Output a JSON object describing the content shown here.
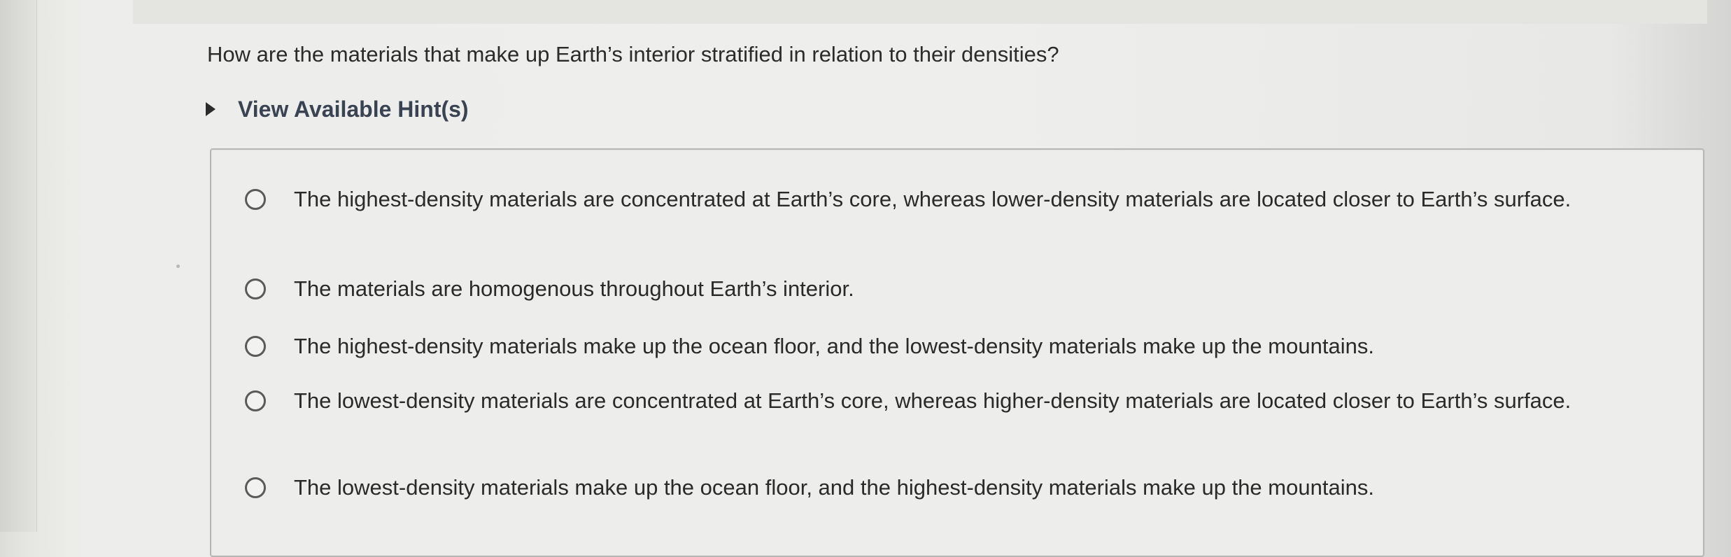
{
  "question": {
    "text": "How are the materials that make up Earth’s interior stratified in relation to their densities?"
  },
  "hint": {
    "label": "View Available Hint(s)",
    "icon": "triangle-right-icon"
  },
  "options": [
    {
      "text": "The highest-density materials are concentrated at Earth’s core, whereas lower-density materials are located closer to Earth’s surface.",
      "selected": false
    },
    {
      "text": "The materials are homogenous throughout Earth’s interior.",
      "selected": false
    },
    {
      "text": "The highest-density materials make up the ocean floor, and the lowest-density materials make up the mountains.",
      "selected": false
    },
    {
      "text": "The lowest-density materials are concentrated at Earth’s core, whereas higher-density materials are located closer to Earth’s surface.",
      "selected": false
    },
    {
      "text": "The lowest-density materials make up the ocean floor, and the highest-density materials make up the mountains.",
      "selected": false
    }
  ],
  "colors": {
    "text": "#2a2a2a",
    "hint_text": "#3a4352",
    "border": "#b6b6b4",
    "background": "#eeeeec"
  }
}
